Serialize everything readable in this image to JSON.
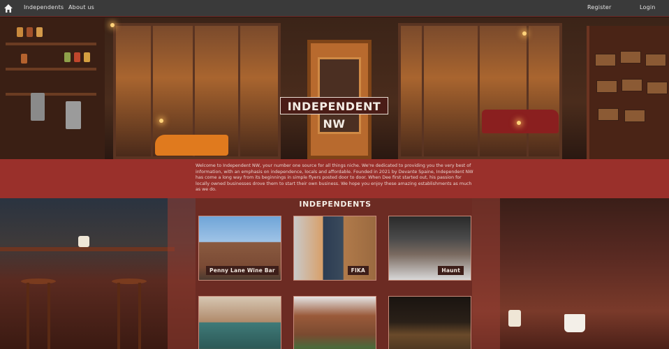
{
  "nav": {
    "home_icon": "home-icon",
    "links": [
      "Independents",
      "About us"
    ],
    "register": "Register",
    "login": "Login"
  },
  "hero": {
    "title": "INDEPENDENT NW"
  },
  "intro": {
    "text": "Welcome to Independent NW, your number one source for all things niche. We're dedicated to providing you the very best of information, with an emphasis on independence, locals and affordable. Founded in 2021 by Devante Spaine, Independent NW has come a long way from its beginnings in simple flyers posted door to door. When Dee first started out, his passion for locally owned businesses drove them to start their own business. We hope you enjoy these amazing establishments as much as we do."
  },
  "independents": {
    "title": "INDEPENDENTS",
    "cards": [
      {
        "name": "Penny Lane Wine Bar"
      },
      {
        "name": "FIKA"
      },
      {
        "name": "Haunt"
      },
      {
        "name": ""
      },
      {
        "name": ""
      },
      {
        "name": ""
      }
    ]
  },
  "colors": {
    "nav_bg": "#3a3a3a",
    "accent": "#9a302b",
    "label_bg": "#3d1e19"
  }
}
